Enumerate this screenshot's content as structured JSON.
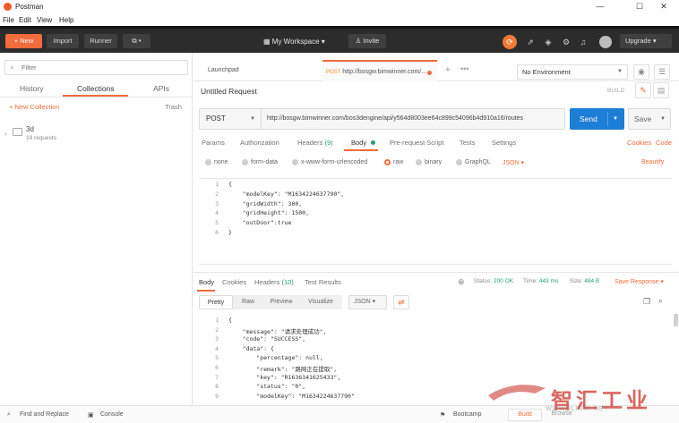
{
  "window": {
    "title": "Postman",
    "minimize": "—",
    "maximize": "☐",
    "close": "✕"
  },
  "menu": [
    "File",
    "Edit",
    "View",
    "Help"
  ],
  "header": {
    "new_label": "+ New",
    "import_label": "Import",
    "runner_label": "Runner",
    "new_window_label": "⧉ ▾",
    "workspace_label": "▦  My Workspace  ▾",
    "invite_label": "♙ Invite",
    "upgrade_label": "Upgrade  ▾"
  },
  "sidebar": {
    "filter_placeholder": "Filter",
    "tabs": [
      "History",
      "Collections",
      "APIs"
    ],
    "active_tab": "Collections",
    "new_collection_label": "+ New Collection",
    "trash_label": "Trash",
    "collection": {
      "name": "3d",
      "count": "19 requests"
    }
  },
  "tabs": {
    "launchpad": "Launchpad",
    "post_method": "POST",
    "post_url": "http://bosgw.bimwinner.com/...",
    "plus": "+",
    "more": "•••"
  },
  "environment": {
    "selected": "No Environment"
  },
  "request": {
    "title": "Untitled Request",
    "build": "BUILD",
    "method": "POST",
    "url": "http://bosgw.bimwinner.com/bos3dengine/api/y564d8003ee64c899c54096b4d910a16/routes",
    "send": "Send",
    "save": "Save"
  },
  "param_tabs": {
    "params": "Params",
    "authorization": "Authorization",
    "headers": "Headers",
    "headers_count": "(9)",
    "body": "Body",
    "prerequest": "Pre-request Script",
    "tests": "Tests",
    "settings": "Settings",
    "cookies": "Cookies",
    "code": "Code"
  },
  "body_options": {
    "none": "none",
    "form_data": "form-data",
    "urlencoded": "x-www-form-urlencoded",
    "raw": "raw",
    "binary": "binary",
    "graphql": "GraphQL",
    "format": "JSON  ▾",
    "beautify": "Beautify",
    "selected": "raw"
  },
  "request_body": [
    {
      "n": "1",
      "t": "{"
    },
    {
      "n": "2",
      "t": "    \"modelKey\": \"M1634224637790\","
    },
    {
      "n": "3",
      "t": "    \"gridWidth\": 300,"
    },
    {
      "n": "4",
      "t": "    \"gridHeight\": 1500,"
    },
    {
      "n": "5",
      "t": "    \"outDoor\":true"
    },
    {
      "n": "6",
      "t": "}"
    }
  ],
  "response": {
    "tabs": {
      "body": "Body",
      "cookies": "Cookies",
      "headers": "Headers",
      "headers_count": "(10)",
      "test_results": "Test Results"
    },
    "status_label": "Status:",
    "status_value": "200 OK",
    "time_label": "Time:",
    "time_value": "443 ms",
    "size_label": "Size:",
    "size_value": "484 B",
    "save_response": "Save Response  ▾",
    "views": [
      "Pretty",
      "Raw",
      "Preview",
      "Visualize"
    ],
    "format": "JSON  ▾",
    "lines": [
      {
        "n": "1",
        "t": "{"
      },
      {
        "n": "2",
        "t": "    \"message\": \"请求处理成功\","
      },
      {
        "n": "3",
        "t": "    \"code\": \"SUCCESS\","
      },
      {
        "n": "4",
        "t": "    \"data\": {"
      },
      {
        "n": "5",
        "t": "        \"percentage\": null,"
      },
      {
        "n": "6",
        "t": "        \"remark\": \"路网正在提取\","
      },
      {
        "n": "7",
        "t": "        \"key\": \"R1636341625433\","
      },
      {
        "n": "8",
        "t": "        \"status\": \"0\","
      },
      {
        "n": "9",
        "t": "        \"modelKey\": \"M1634224637790\""
      }
    ]
  },
  "statusbar": {
    "find_replace": "Find and Replace",
    "console": "Console",
    "bootcamp": "Bootcamp",
    "build": "Build",
    "browse": "Browse"
  },
  "watermark": {
    "text": "智汇工业",
    "url": "WWW.ILINKI.NET"
  },
  "colors": {
    "accent": "#f26b3a",
    "send": "#1d7ed6",
    "ok": "#25a06d",
    "header": "#2c2c2c"
  }
}
